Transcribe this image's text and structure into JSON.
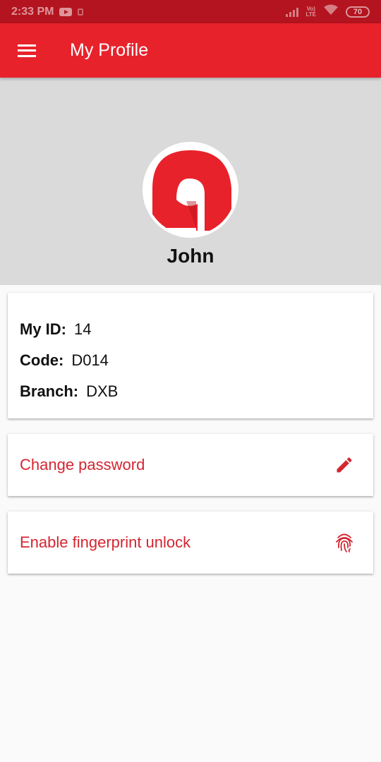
{
  "status_bar": {
    "time": "2:33 PM",
    "volte_top": "Vo)",
    "volte_bottom": "LTE",
    "battery": "70"
  },
  "app_bar": {
    "title": "My Profile",
    "menu_icon": "hamburger-menu-icon"
  },
  "profile": {
    "name": "John",
    "avatar_icon": "app-logo-icon"
  },
  "info": {
    "id_label": "My ID:",
    "id_value": "14",
    "code_label": "Code:",
    "code_value": "D014",
    "branch_label": "Branch:",
    "branch_value": "DXB"
  },
  "actions": {
    "change_password": {
      "label": "Change password",
      "icon": "pencil-icon"
    },
    "fingerprint": {
      "label": "Enable fingerprint unlock",
      "icon": "fingerprint-icon"
    }
  },
  "colors": {
    "status_bar": "#b3141f",
    "app_bar": "#e8222b",
    "accent_text": "#d32631",
    "header_bg": "#dadada",
    "page_bg": "#fafafa"
  }
}
